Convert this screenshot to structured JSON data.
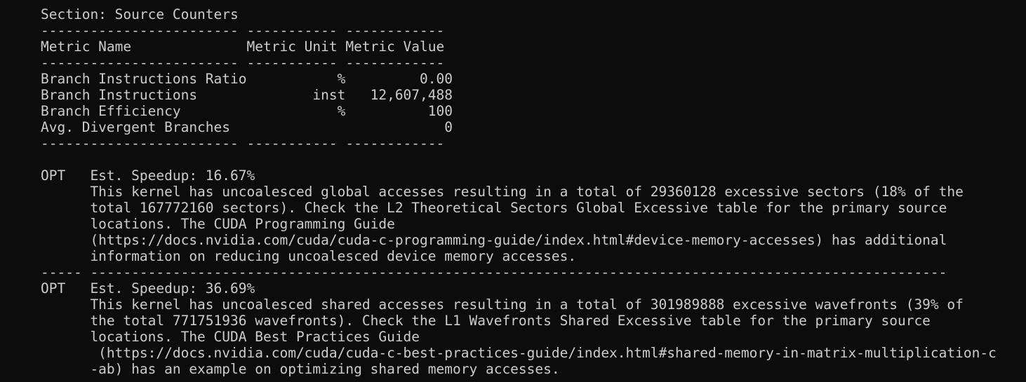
{
  "section": {
    "title_line": "Section: Source Counters",
    "sep_line": "------------------------ ----------- ------------",
    "header_line": "Metric Name              Metric Unit Metric Value",
    "rows": [
      "Branch Instructions Ratio           %         0.00",
      "Branch Instructions              inst   12,607,488",
      "Branch Efficiency                   %          100",
      "Avg. Divergent Branches                          0"
    ]
  },
  "blank_line": "",
  "opt_blocks": [
    {
      "lines": [
        "OPT   Est. Speedup: 16.67%",
        "      This kernel has uncoalesced global accesses resulting in a total of 29360128 excessive sectors (18% of the",
        "      total 167772160 sectors). Check the L2 Theoretical Sectors Global Excessive table for the primary source",
        "      locations. The CUDA Programming Guide",
        "      (https://docs.nvidia.com/cuda/cuda-c-programming-guide/index.html#device-memory-accesses) has additional",
        "      information on reducing uncoalesced device memory accesses."
      ]
    },
    {
      "lines": [
        "OPT   Est. Speedup: 36.69%",
        "      This kernel has uncoalesced shared accesses resulting in a total of 301989888 excessive wavefronts (39% of",
        "      the total 771751936 wavefronts). Check the L1 Wavefronts Shared Excessive table for the primary source",
        "      locations. The CUDA Best Practices Guide",
        "       (https://docs.nvidia.com/cuda/cuda-c-best-practices-guide/index.html#shared-memory-in-matrix-multiplication-c",
        "      -ab) has an example on optimizing shared memory accesses."
      ]
    }
  ],
  "block_separator": "----- --------------------------------------------------------------------------------------------------------"
}
